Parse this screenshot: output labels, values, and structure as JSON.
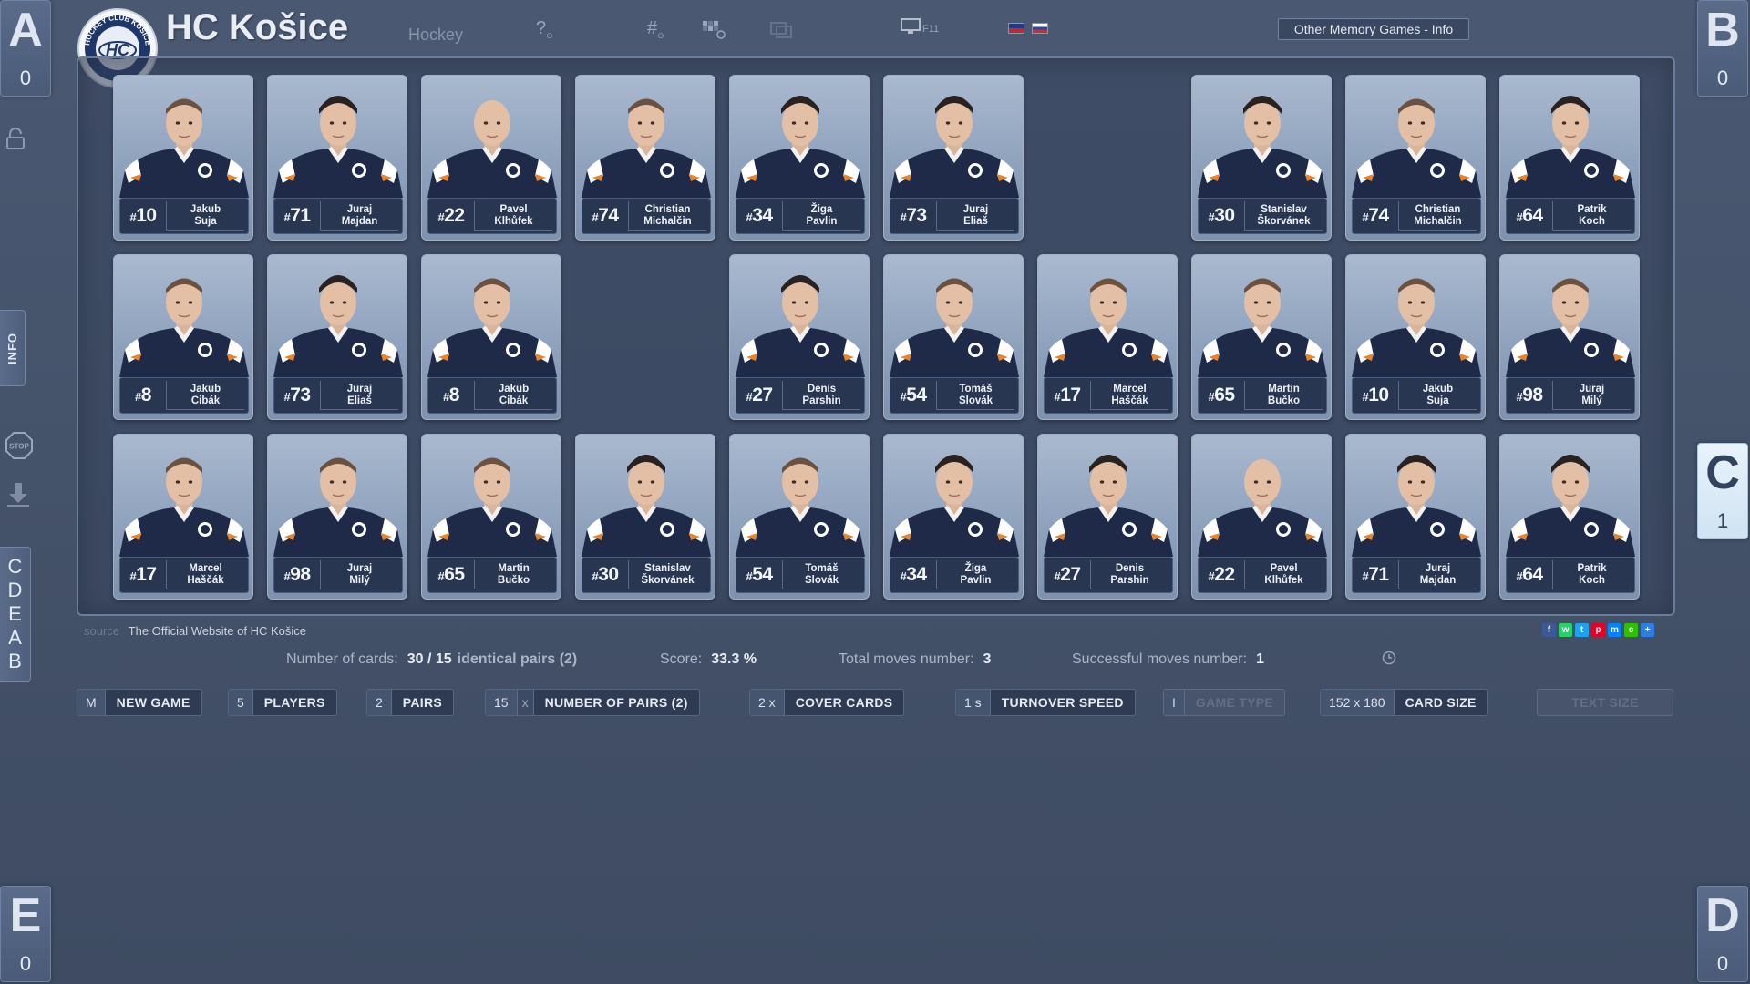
{
  "header": {
    "title": "HC Košice",
    "subtitle": "Hockey",
    "logo_text": "HOCKEY CLUB KOŠICE",
    "help_icon": "question-icon",
    "number_icon": "hash-icon",
    "grid_icon": "grid-icon",
    "fullscreen_key": "F11",
    "other_games": "Other Memory Games - Info"
  },
  "players": [
    {
      "letter": "A",
      "score": "0",
      "active": false
    },
    {
      "letter": "B",
      "score": "0",
      "active": false
    },
    {
      "letter": "C",
      "score": "1",
      "active": true
    },
    {
      "letter": "D",
      "score": "0",
      "active": false
    },
    {
      "letter": "E",
      "score": "0",
      "active": false
    }
  ],
  "sidebar": {
    "info_label": "INFO",
    "stop_label": "STOP",
    "order": [
      "C",
      "D",
      "E",
      "A",
      "B"
    ]
  },
  "cards": [
    {
      "row": 0,
      "col": 0,
      "number": "10",
      "first": "Jakub",
      "last": "Suja",
      "face": "a"
    },
    {
      "row": 0,
      "col": 1,
      "number": "71",
      "first": "Juraj",
      "last": "Majdan",
      "face": "d"
    },
    {
      "row": 0,
      "col": 2,
      "number": "22",
      "first": "Pavel",
      "last": "Klhůfek",
      "face": "bald"
    },
    {
      "row": 0,
      "col": 3,
      "number": "74",
      "first": "Christian",
      "last": "Michalčin",
      "face": "a"
    },
    {
      "row": 0,
      "col": 4,
      "number": "34",
      "first": "Žiga",
      "last": "Pavlin",
      "face": "d"
    },
    {
      "row": 0,
      "col": 5,
      "number": "73",
      "first": "Juraj",
      "last": "Eliaš",
      "face": "d"
    },
    {
      "row": 0,
      "col": 7,
      "number": "30",
      "first": "Stanislav",
      "last": "Škorvánek",
      "face": "d"
    },
    {
      "row": 0,
      "col": 8,
      "number": "74",
      "first": "Christian",
      "last": "Michalčin",
      "face": "a"
    },
    {
      "row": 0,
      "col": 9,
      "number": "64",
      "first": "Patrik",
      "last": "Koch",
      "face": "d"
    },
    {
      "row": 1,
      "col": 0,
      "number": "8",
      "first": "Jakub",
      "last": "Cibák",
      "face": "a"
    },
    {
      "row": 1,
      "col": 1,
      "number": "73",
      "first": "Juraj",
      "last": "Eliaš",
      "face": "d"
    },
    {
      "row": 1,
      "col": 2,
      "number": "8",
      "first": "Jakub",
      "last": "Cibák",
      "face": "a"
    },
    {
      "row": 1,
      "col": 4,
      "number": "27",
      "first": "Denis",
      "last": "Parshin",
      "face": "d"
    },
    {
      "row": 1,
      "col": 5,
      "number": "54",
      "first": "Tomáš",
      "last": "Slovák",
      "face": "a"
    },
    {
      "row": 1,
      "col": 6,
      "number": "17",
      "first": "Marcel",
      "last": "Haščák",
      "face": "a"
    },
    {
      "row": 1,
      "col": 7,
      "number": "65",
      "first": "Martin",
      "last": "Bučko",
      "face": "a"
    },
    {
      "row": 1,
      "col": 8,
      "number": "10",
      "first": "Jakub",
      "last": "Suja",
      "face": "a"
    },
    {
      "row": 1,
      "col": 9,
      "number": "98",
      "first": "Juraj",
      "last": "Milý",
      "face": "a"
    },
    {
      "row": 2,
      "col": 0,
      "number": "17",
      "first": "Marcel",
      "last": "Haščák",
      "face": "a"
    },
    {
      "row": 2,
      "col": 1,
      "number": "98",
      "first": "Juraj",
      "last": "Milý",
      "face": "a"
    },
    {
      "row": 2,
      "col": 2,
      "number": "65",
      "first": "Martin",
      "last": "Bučko",
      "face": "a"
    },
    {
      "row": 2,
      "col": 3,
      "number": "30",
      "first": "Stanislav",
      "last": "Škorvánek",
      "face": "d"
    },
    {
      "row": 2,
      "col": 4,
      "number": "54",
      "first": "Tomáš",
      "last": "Slovák",
      "face": "a"
    },
    {
      "row": 2,
      "col": 5,
      "number": "34",
      "first": "Žiga",
      "last": "Pavlin",
      "face": "d"
    },
    {
      "row": 2,
      "col": 6,
      "number": "27",
      "first": "Denis",
      "last": "Parshin",
      "face": "d"
    },
    {
      "row": 2,
      "col": 7,
      "number": "22",
      "first": "Pavel",
      "last": "Klhůfek",
      "face": "bald"
    },
    {
      "row": 2,
      "col": 8,
      "number": "71",
      "first": "Juraj",
      "last": "Majdan",
      "face": "d"
    },
    {
      "row": 2,
      "col": 9,
      "number": "64",
      "first": "Patrik",
      "last": "Koch",
      "face": "d"
    }
  ],
  "source": {
    "label": "source",
    "name": "The Official Website of HC Košice"
  },
  "share_icons": [
    {
      "name": "facebook-icon",
      "glyph": "f",
      "color": "#3b5998"
    },
    {
      "name": "whatsapp-icon",
      "glyph": "w",
      "color": "#25d366"
    },
    {
      "name": "twitter-icon",
      "glyph": "t",
      "color": "#1da1f2"
    },
    {
      "name": "pinterest-icon",
      "glyph": "p",
      "color": "#e60023"
    },
    {
      "name": "messenger-icon",
      "glyph": "m",
      "color": "#0084ff"
    },
    {
      "name": "wechat-icon",
      "glyph": "c",
      "color": "#2dc100"
    },
    {
      "name": "more-share-icon",
      "glyph": "+",
      "color": "#2e7de1"
    }
  ],
  "stats": {
    "cards_label": "Number of cards:",
    "cards_value": "30 / 15",
    "cards_extra": "identical pairs (2)",
    "score_label": "Score:",
    "score_value": "33.3 %",
    "moves_label": "Total moves number:",
    "moves_value": "3",
    "success_label": "Successful moves number:",
    "success_value": "1"
  },
  "controls": {
    "new_game": {
      "key": "M",
      "label": "NEW GAME"
    },
    "players": {
      "key": "5",
      "label": "PLAYERS"
    },
    "pairs": {
      "key": "2",
      "label": "PAIRS"
    },
    "num_pairs": {
      "key": "15",
      "x": "x",
      "label": "NUMBER OF PAIRS (2)"
    },
    "cover": {
      "key": "2 x",
      "label": "COVER CARDS"
    },
    "speed": {
      "key": "1 s",
      "label": "TURNOVER SPEED"
    },
    "game_type": {
      "key": "I",
      "label": "GAME TYPE"
    },
    "card_size": {
      "key": "152 x 180",
      "label": "CARD SIZE"
    },
    "text_size": {
      "label": "TEXT SIZE"
    }
  },
  "colors": {
    "background": "#45536b",
    "card_label_bg": "#283651",
    "active_player": "#e9f3fb",
    "jersey": "#1e2a48",
    "jersey_accent": "#e8842a"
  }
}
